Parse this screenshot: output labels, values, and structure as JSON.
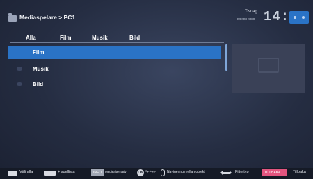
{
  "header": {
    "title": "Mediaspelare > PC1",
    "day": "Tisdag",
    "date": "xx xxx xxxx",
    "time": "14:00"
  },
  "tabs": [
    {
      "label": "Alla"
    },
    {
      "label": "Film"
    },
    {
      "label": "Musik"
    },
    {
      "label": "Bild"
    }
  ],
  "list": {
    "items": [
      {
        "label": "Film",
        "selected": true
      },
      {
        "label": "Musik",
        "selected": false
      },
      {
        "label": "Bild",
        "selected": false
      }
    ]
  },
  "footer": {
    "select_all": "Välj alla",
    "playlist": "+ spellista",
    "media_options_key": "INFO",
    "media_options": "Mediealternativ",
    "ok_key": "OK",
    "sync": "Synkopp",
    "navigate": "Navigering mellan objekt",
    "filter": "Filtertyp",
    "back_key": "TILLBAKA",
    "back": "Tillbaka"
  },
  "colors": {
    "accent": "#2a73c6",
    "background": "#252d42",
    "back_key": "#e2557f"
  },
  "icons": {
    "header": "folder-icon",
    "preview": "video-thumbnail-icon"
  }
}
